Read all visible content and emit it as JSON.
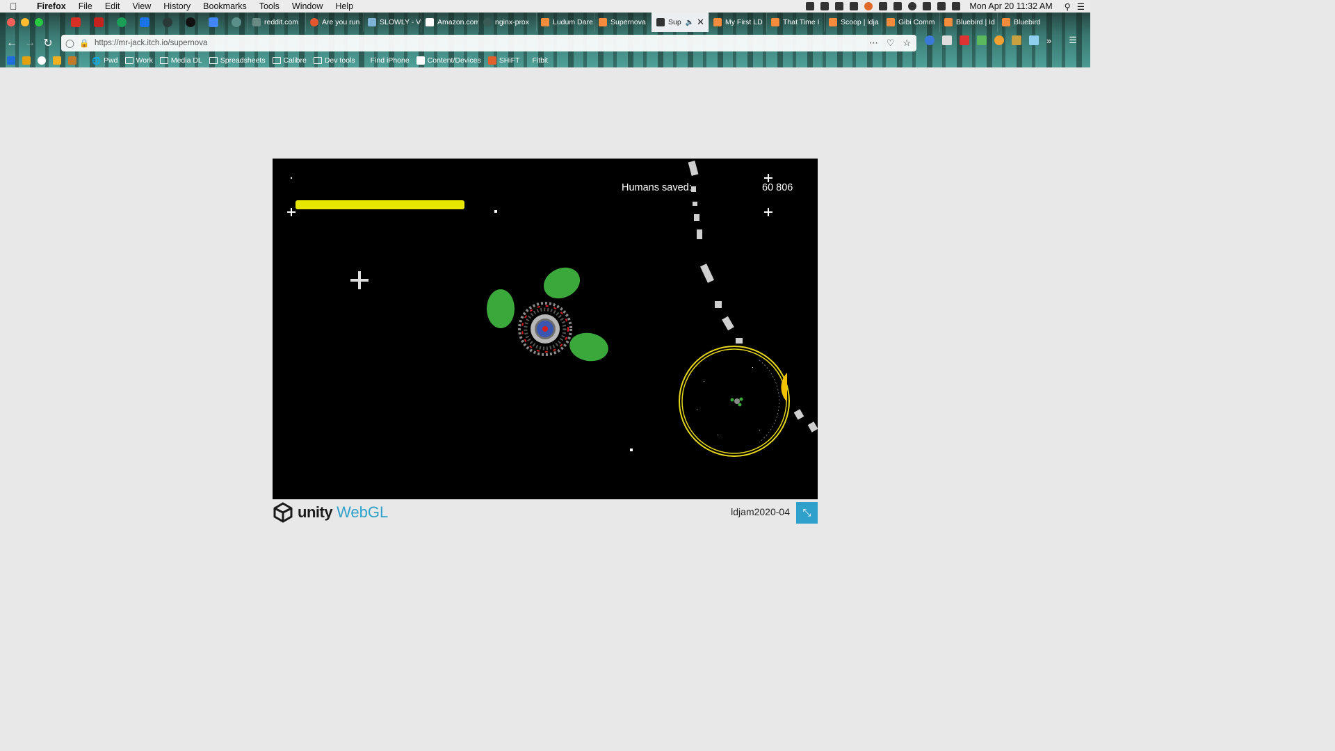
{
  "menubar": {
    "app": "Firefox",
    "menus": [
      "File",
      "Edit",
      "View",
      "History",
      "Bookmarks",
      "Tools",
      "Window",
      "Help"
    ],
    "clock": "Mon Apr 20  11:32 AM"
  },
  "tabs": [
    {
      "label": "reddit.com",
      "fav": "#6a8a86"
    },
    {
      "label": "Are you run",
      "fav": "#e4572e"
    },
    {
      "label": "SLOWLY - V",
      "fav": "#7fb3d5"
    },
    {
      "label": "Amazon.com",
      "fav": "#222222"
    },
    {
      "label": "nginx-prox",
      "fav": "#3a5a56"
    },
    {
      "label": "Ludum Dare",
      "fav": "#f58b3c"
    },
    {
      "label": "Supernova",
      "fav": "#f58b3c"
    },
    {
      "label": "Sup",
      "fav": "#333333",
      "active": true
    },
    {
      "label": "My First LD",
      "fav": "#f58b3c"
    },
    {
      "label": "That Time I",
      "fav": "#f58b3c"
    },
    {
      "label": "Scoop | ldja",
      "fav": "#f58b3c"
    },
    {
      "label": "Gibi Comm",
      "fav": "#f58b3c"
    },
    {
      "label": "Bluebird | Id",
      "fav": "#f58b3c"
    },
    {
      "label": "Bluebird",
      "fav": "#f58b3c"
    }
  ],
  "address": {
    "url": "https://mr-jack.itch.io/supernova"
  },
  "bookmarks": [
    "Pwd",
    "Work",
    "Media DL",
    "Spreadsheets",
    "Calibre",
    "Dev tools",
    "Find iPhone",
    "Content/Devices",
    "SHiFT",
    "Fitbit"
  ],
  "game": {
    "hud_label": "Humans saved:",
    "hud_value": "60 806",
    "energy_level": 1.0
  },
  "footer": {
    "brand": "unity",
    "brand_suffix": "WebGL",
    "build_name": "ldjam2020-04"
  },
  "colors": {
    "energy_bar": "#e6e600",
    "ring": "#e6d81a",
    "planet": "#3ba83b",
    "webgl_accent": "#2ea0c9"
  }
}
